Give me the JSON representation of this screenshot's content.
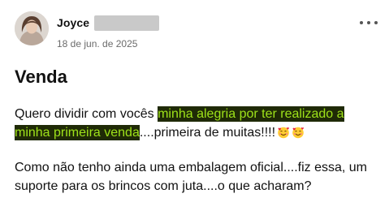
{
  "author": {
    "name": "Joyce",
    "date": "18 de jun. de 2025"
  },
  "post": {
    "title": "Venda",
    "para1": {
      "before": "Quero dividir com vocês ",
      "highlight_line1": "minha alegria por ter realizado a",
      "highlight_line2": "minha primeira venda",
      "after": "....primeira de muitas!!!!"
    },
    "para2": "Como não tenho ainda uma embalagem oficial....fiz essa, um suporte para os brincos com juta....o que acharam?"
  },
  "icons": {
    "avatar": "user-avatar-photo",
    "more": "more-options-icon",
    "emoji": "smiling-face-with-hearts-emoji"
  },
  "colors": {
    "highlight_bg": "#1f2a06",
    "highlight_text": "#9ee21a"
  }
}
